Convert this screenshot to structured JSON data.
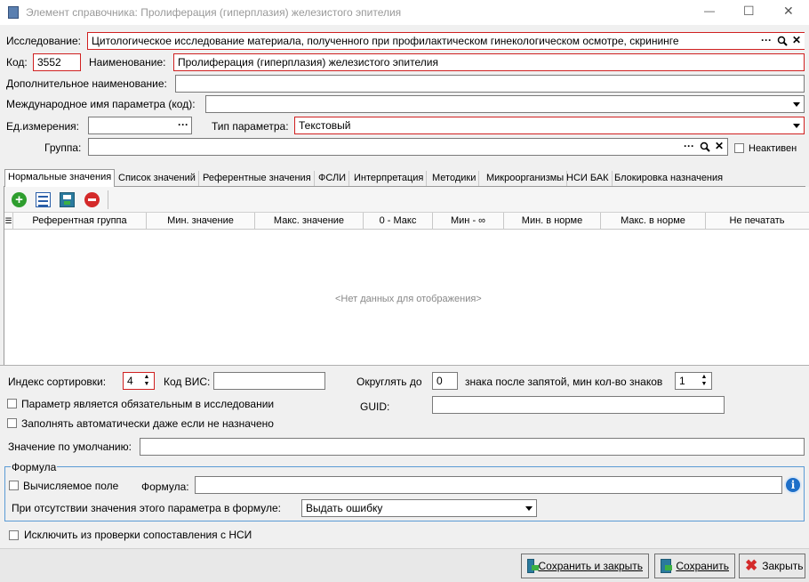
{
  "window": {
    "title": "Элемент справочника: Пролиферация (гиперплазия) железистого эпителия",
    "minimize_glyph": "—",
    "maximize_glyph": "☐",
    "close_glyph": "✕"
  },
  "form": {
    "study_label": "Исследование:",
    "study_value": "Цитологическое исследование материала, полученного при профилактическом гинекологическом осмотре, скрининге",
    "code_label": "Код:",
    "code_value": "3552",
    "name_label": "Наименование:",
    "name_value": "Пролиферация (гиперплазия) железистого эпителия",
    "extra_name_label": "Дополнительное наименование:",
    "extra_name_value": "",
    "intl_name_label": "Международное имя параметра (код):",
    "intl_name_value": "",
    "unit_label": "Ед.измерения:",
    "unit_value": "",
    "param_type_label": "Тип параметра:",
    "param_type_value": "Текстовый",
    "group_label": "Группа:",
    "group_value": "",
    "inactive_label": "Неактивен"
  },
  "tabs": [
    {
      "label": "Нормальные значения",
      "active": true
    },
    {
      "label": "Список значений"
    },
    {
      "label": "Референтные значения"
    },
    {
      "label": "ФСЛИ"
    },
    {
      "label": "Интерпретация"
    },
    {
      "label": "Методики"
    },
    {
      "label": "Микроорганизмы"
    },
    {
      "label": "НСИ БАК"
    },
    {
      "label": "Блокировка назначения"
    }
  ],
  "grid": {
    "columns": [
      "Референтная группа",
      "Мин. значение",
      "Макс. значение",
      "0 - Макс",
      "Мин - ∞",
      "Мин. в норме",
      "Макс. в норме",
      "Не печатать"
    ],
    "empty_text": "<Нет данных для отображения>"
  },
  "bottom": {
    "sort_index_label": "Индекс сортировки:",
    "sort_index_value": "4",
    "vis_code_label": "Код ВИС:",
    "vis_code_value": "",
    "round_label": "Округлять до",
    "round_value": "0",
    "decimals_label": "знака после запятой, мин кол-во знаков",
    "decimals_value": "1",
    "mandatory_label": "Параметр является обязательным в исследовании",
    "autofill_label": "Заполнять автоматически даже если не назначено",
    "guid_label": "GUID:",
    "guid_value": "",
    "default_label": "Значение по умолчанию:",
    "default_value": "",
    "formula_group_label": "Формула",
    "computed_label": "Вычисляемое поле",
    "formula_label": "Формула:",
    "formula_value": "",
    "missing_label": "При отсутствии значения этого параметра в формуле:",
    "missing_value": "Выдать ошибку",
    "exclude_label": "Исключить из проверки сопоставления с НСИ"
  },
  "buttons": {
    "save_close": "Сохранить и закрыть",
    "save": "Сохранить",
    "close": "Закрыть"
  },
  "colors": {
    "required_border": "#d02020",
    "add_icon": "#2e9e2e",
    "delete_icon": "#d42a2a",
    "info_icon": "#1e6fc8"
  }
}
